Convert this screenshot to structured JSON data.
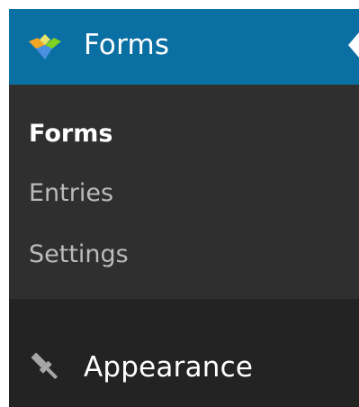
{
  "menu": {
    "active": {
      "label": "Forms",
      "icon": "gravity-forms-icon",
      "accent_color": "#0a6fa3"
    },
    "submenu": [
      {
        "label": "Forms",
        "current": true
      },
      {
        "label": "Entries",
        "current": false
      },
      {
        "label": "Settings",
        "current": false
      }
    ],
    "next": {
      "label": "Appearance",
      "icon": "paintbrush-icon"
    }
  }
}
